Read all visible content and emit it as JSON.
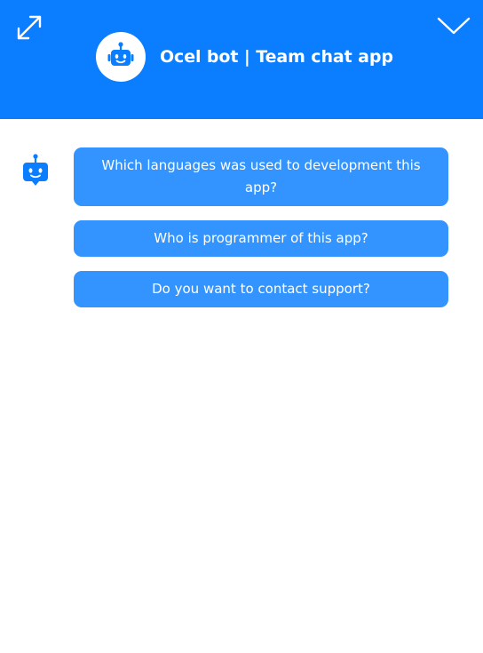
{
  "header": {
    "title": "Ocel bot | Team chat app",
    "expand_icon": "expand-arrows-icon",
    "collapse_icon": "chevron-down-icon",
    "avatar_icon": "robot-icon"
  },
  "colors": {
    "header_bg": "#0B7DFF",
    "option_bg": "#3394FF",
    "text_light": "#FFFFFF"
  },
  "messages": {
    "bot_icon": "robot-icon",
    "options": [
      "Which languages was used to development this app?",
      "Who is programmer of this app?",
      "Do you want to contact support?"
    ]
  }
}
